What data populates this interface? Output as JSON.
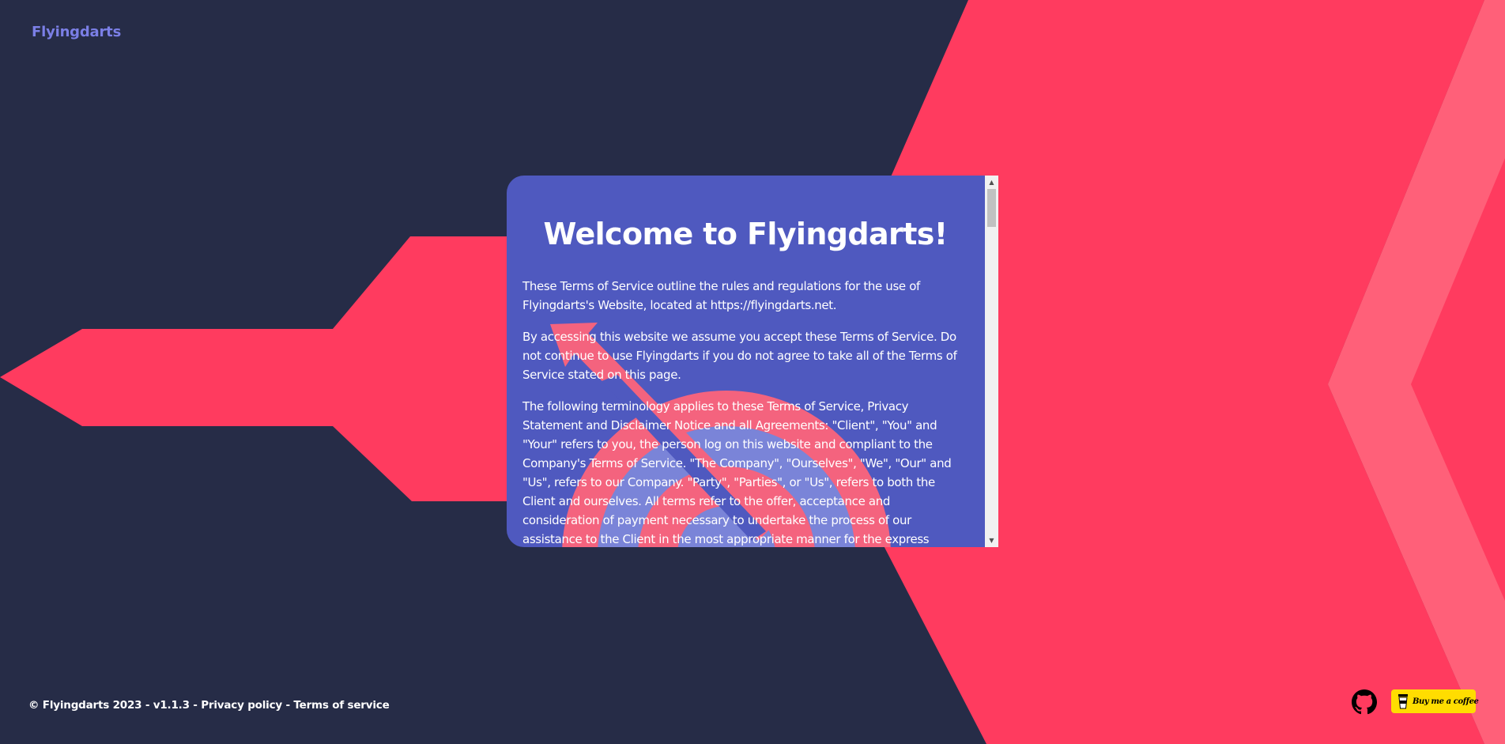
{
  "brand": {
    "name": "Flyingdarts"
  },
  "dialog": {
    "title": "Welcome to Flyingdarts!",
    "paragraphs": [
      "These Terms of Service outline the rules and regulations for the use of Flyingdarts's Website, located at https://flyingdarts.net.",
      "By accessing this website we assume you accept these Terms of Service. Do not continue to use Flyingdarts if you do not agree to take all of the Terms of Service stated on this page.",
      "The following terminology applies to these Terms of Service, Privacy Statement and Disclaimer Notice and all Agreements: \"Client\", \"You\" and \"Your\" refers to you, the person log on this website and compliant to the Company's Terms of Service. \"The Company\", \"Ourselves\", \"We\", \"Our\" and \"Us\", refers to our Company. \"Party\", \"Parties\", or \"Us\", refers to both the Client and ourselves. All terms refer to the offer, acceptance and consideration of payment necessary to undertake the process of our assistance to the Client in the most appropriate manner for the express purpose of meeting the Client's needs in respect of"
    ]
  },
  "footer": {
    "copyright": "© Flyingdarts 2023",
    "separator": " - ",
    "version": "v1.1.3",
    "privacy_link": "Privacy policy",
    "terms_link": "Terms of service"
  },
  "actions": {
    "github_icon": "github-icon",
    "coffee_label": "Buy me a coffee"
  },
  "colors": {
    "background": "#262c47",
    "accent_red": "#ff3b5f",
    "accent_pink": "#ff6079",
    "dialog_bg": "#4f59bf",
    "brand": "#7b7fe6",
    "coffee_bg": "#ffdd00"
  }
}
